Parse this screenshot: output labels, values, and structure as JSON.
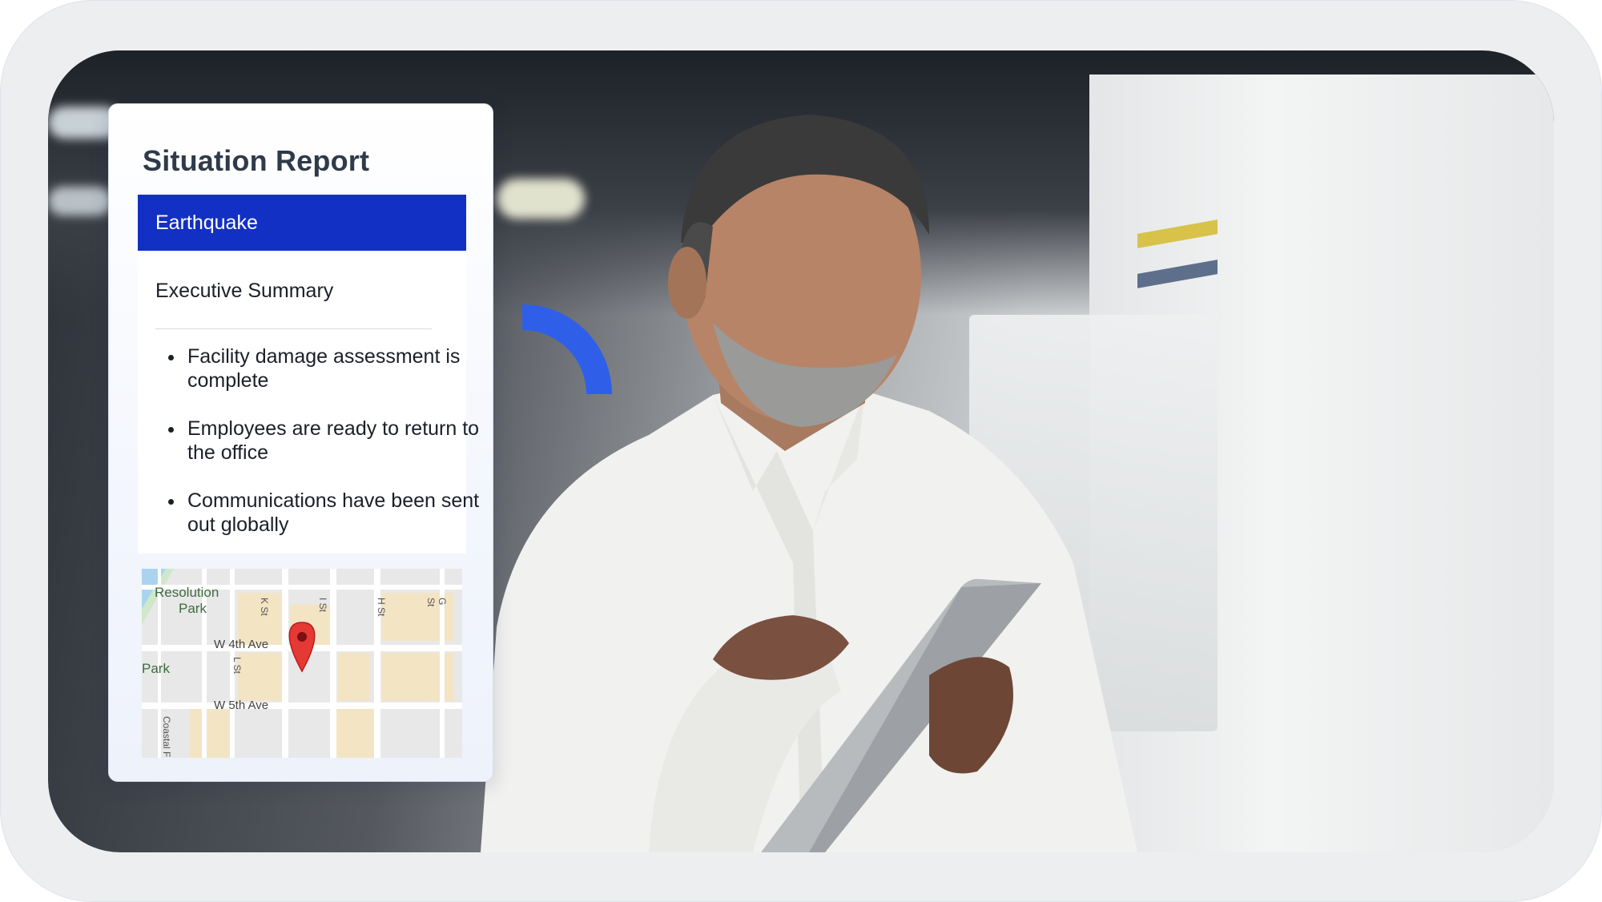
{
  "report": {
    "title": "Situation Report",
    "active_tab": "Earthquake",
    "section_title": "Executive Summary",
    "bullets": [
      "Facility damage assessment is complete",
      "Employees are ready to return to the office",
      "Communications have been sent out globally"
    ]
  },
  "map": {
    "park_label_1": "Resolution",
    "park_label_2": "Park",
    "park_label_3": "Park",
    "streets": {
      "w4": "W 4th Ave",
      "w5": "W 5th Ave",
      "k": "K St",
      "i": "I St",
      "h": "H St",
      "g": "G St",
      "l": "L St",
      "coastal": "Coastal F"
    },
    "pin_color": "#e53935"
  },
  "colors": {
    "accent": "#1330c4",
    "arc": "#2f5fe8"
  }
}
